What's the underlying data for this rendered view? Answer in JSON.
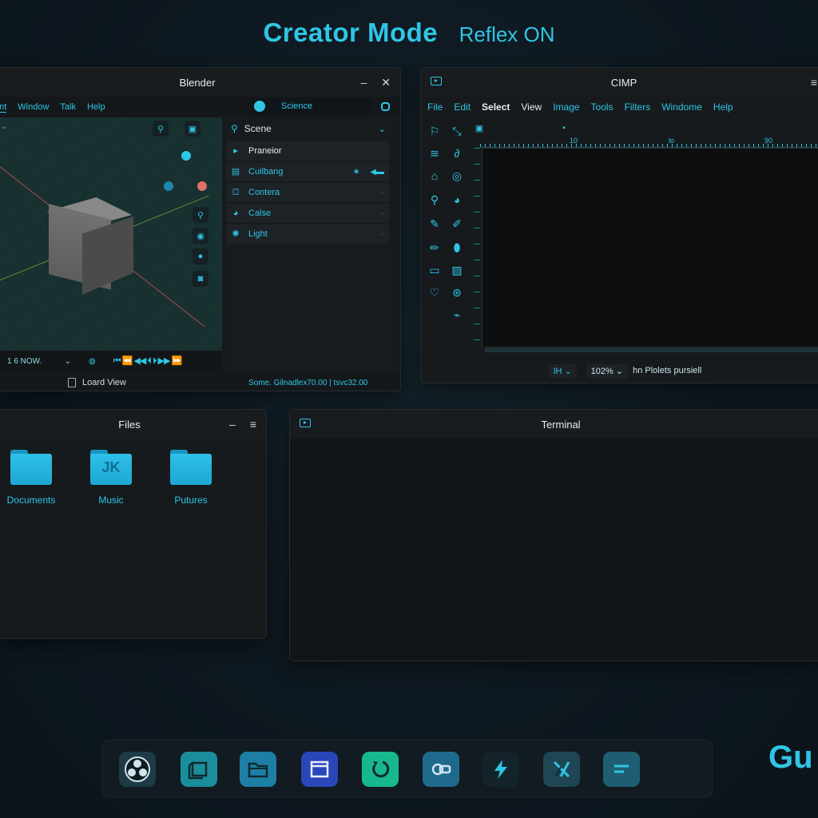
{
  "header": {
    "title": "Creator Mode",
    "status": "Reflex ON"
  },
  "colors": {
    "accent": "#2fc6e6",
    "background": "#0e1820",
    "window": "#161a1d"
  },
  "blender": {
    "title": "Blender",
    "menu": [
      "ont",
      "Window",
      "Talk",
      "Help"
    ],
    "workspace_label": "Science",
    "outliner_title": "Scene",
    "outliner_items": [
      {
        "label": "Praneior",
        "icon": "collection-icon"
      },
      {
        "label": "Cuilbang",
        "icon": "object-icon"
      },
      {
        "label": "Contera",
        "icon": "camera-icon"
      },
      {
        "label": "Calse",
        "icon": "mesh-icon"
      },
      {
        "label": "Light",
        "icon": "light-icon"
      }
    ],
    "frame_label": "1 6 NOW.",
    "transport": "⏮ ⏪ ◀◀ ⏴ ⏵ ▶▶ ⏩",
    "status_left": "Loard View",
    "status_right": "Some. Gilnadlex70.00  |  tsvc32.00"
  },
  "gimp": {
    "title": "CIMP",
    "menu": [
      "File",
      "Edit",
      "Select",
      "View",
      "Image",
      "Tools",
      "Filters",
      "Windome",
      "Help"
    ],
    "ruler_ticks": [
      "10",
      "lo",
      "90"
    ],
    "unit": "lH",
    "zoom": "102%",
    "status_message": "hn Plolets pursiell"
  },
  "files": {
    "title": "Files",
    "folders": [
      {
        "label": "Documents",
        "glyph": ""
      },
      {
        "label": "Music",
        "glyph": "JK"
      },
      {
        "label": "Putures",
        "glyph": ""
      }
    ]
  },
  "terminal": {
    "title": "Terminal"
  },
  "dock": {
    "items": [
      "obs-icon",
      "screenshot-icon",
      "files-icon",
      "window-icon",
      "refresh-icon",
      "toggle-icon",
      "bolt-icon",
      "editor-icon",
      "menu-icon"
    ]
  },
  "brand": "Gu"
}
